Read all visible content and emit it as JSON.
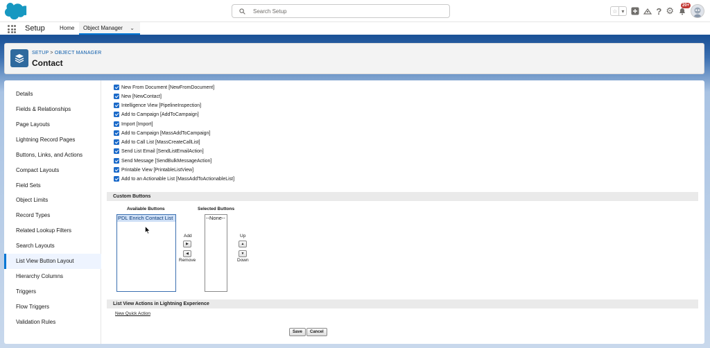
{
  "header": {
    "search_placeholder": "Search Setup",
    "notification_count": "20+"
  },
  "context_nav": {
    "app_name": "Setup",
    "tabs": [
      {
        "label": "Home"
      },
      {
        "label": "Object Manager"
      }
    ]
  },
  "object_header": {
    "breadcrumb_parent1": "SETUP",
    "breadcrumb_sep": ">",
    "breadcrumb_parent2": "OBJECT MANAGER",
    "title": "Contact"
  },
  "sidebar": {
    "items": [
      {
        "label": "Details"
      },
      {
        "label": "Fields & Relationships"
      },
      {
        "label": "Page Layouts"
      },
      {
        "label": "Lightning Record Pages"
      },
      {
        "label": "Buttons, Links, and Actions"
      },
      {
        "label": "Compact Layouts"
      },
      {
        "label": "Field Sets"
      },
      {
        "label": "Object Limits"
      },
      {
        "label": "Record Types"
      },
      {
        "label": "Related Lookup Filters"
      },
      {
        "label": "Search Layouts"
      },
      {
        "label": "List View Button Layout"
      },
      {
        "label": "Hierarchy Columns"
      },
      {
        "label": "Triggers"
      },
      {
        "label": "Flow Triggers"
      },
      {
        "label": "Validation Rules"
      }
    ],
    "active_index": 11
  },
  "standard_buttons": [
    {
      "label": "New From Document [NewFromDocument]",
      "checked": true
    },
    {
      "label": "New [NewContact]",
      "checked": true
    },
    {
      "label": "Intelligence View [PipelineInspection]",
      "checked": true
    },
    {
      "label": "Add to Campaign [AddToCampaign]",
      "checked": true
    },
    {
      "label": "Import [Import]",
      "checked": true
    },
    {
      "label": "Add to Campaign [MassAddToCampaign]",
      "checked": true
    },
    {
      "label": "Add to Call List [MassCreateCallList]",
      "checked": true
    },
    {
      "label": "Send List Email [SendListEmailAction]",
      "checked": true
    },
    {
      "label": "Send Message [SendBulkMessageAction]",
      "checked": true
    },
    {
      "label": "Printable View [PrintableListView]",
      "checked": true
    },
    {
      "label": "Add to an Actionable List [MassAddToActionableList]",
      "checked": true
    }
  ],
  "custom_buttons": {
    "section_title": "Custom Buttons",
    "available_label": "Available Buttons",
    "selected_label": "Selected Buttons",
    "available_options": [
      "PDL Enrich Contact List"
    ],
    "selected_options": [
      "--None--"
    ],
    "add_label": "Add",
    "remove_label": "Remove",
    "up_label": "Up",
    "down_label": "Down"
  },
  "lightning_actions": {
    "section_title": "List View Actions in Lightning Experience",
    "link_label": "New Quick Action"
  },
  "form_buttons": {
    "save": "Save",
    "cancel": "Cancel"
  }
}
